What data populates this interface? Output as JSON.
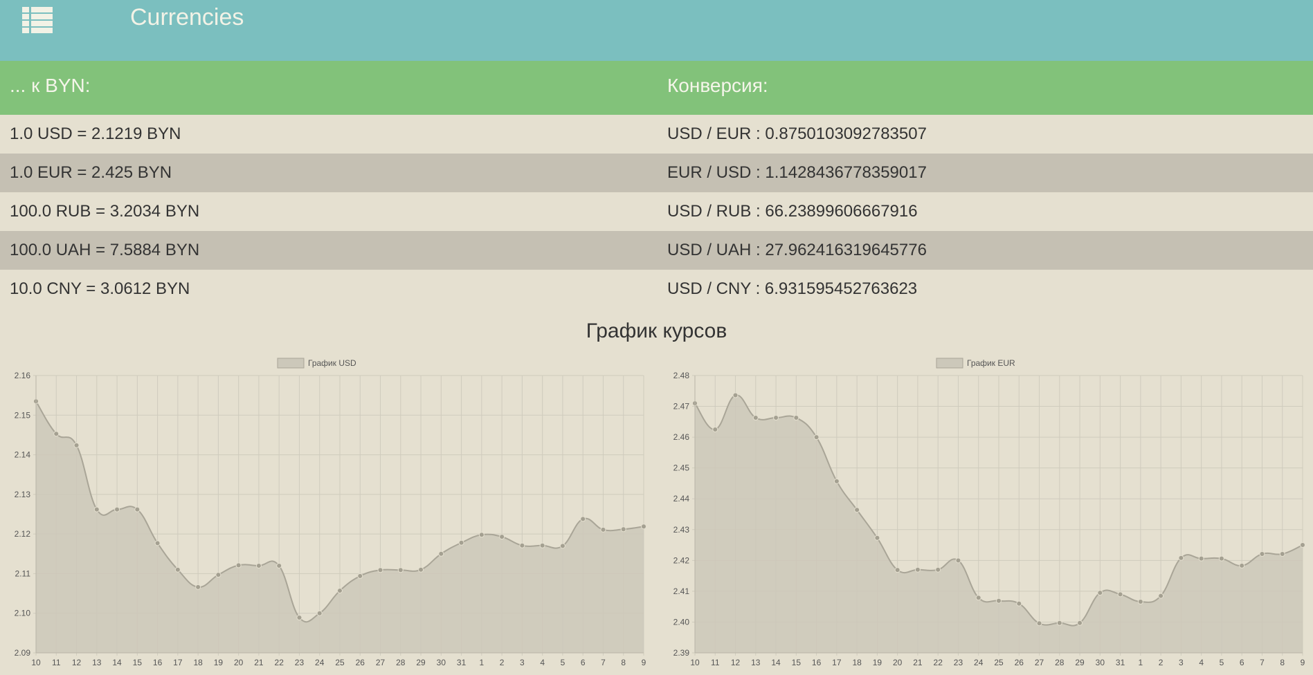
{
  "app": {
    "title": "Currencies",
    "menu_icon": "list-menu-icon"
  },
  "header": {
    "left": "... к BYN:",
    "right": "Конверсия:"
  },
  "rows": [
    {
      "rate": "1.0 USD = 2.1219 BYN",
      "conversion": "USD / EUR : 0.8750103092783507"
    },
    {
      "rate": "1.0 EUR = 2.425 BYN",
      "conversion": "EUR / USD : 1.1428436778359017"
    },
    {
      "rate": "100.0 RUB = 3.2034 BYN",
      "conversion": "USD / RUB : 66.23899606667916"
    },
    {
      "rate": "100.0 UAH = 7.5884 BYN",
      "conversion": "USD / UAH : 27.962416319645776"
    },
    {
      "rate": "10.0 CNY = 3.0612 BYN",
      "conversion": "USD / CNY : 6.931595452763623"
    }
  ],
  "charts_title": "График курсов",
  "chart_data": [
    {
      "type": "area",
      "title": "",
      "categories": [
        "10",
        "11",
        "12",
        "13",
        "14",
        "15",
        "16",
        "17",
        "18",
        "19",
        "20",
        "21",
        "22",
        "23",
        "24",
        "25",
        "26",
        "27",
        "28",
        "29",
        "30",
        "31",
        "1",
        "2",
        "3",
        "4",
        "5",
        "6",
        "7",
        "8",
        "9"
      ],
      "series": [
        {
          "name": "График USD",
          "values": [
            2.1535,
            2.1453,
            2.1424,
            2.1262,
            2.1262,
            2.1262,
            2.1177,
            2.111,
            2.1066,
            2.1097,
            2.1121,
            2.112,
            2.112,
            2.0989,
            2.1,
            2.1057,
            2.1094,
            2.1109,
            2.1109,
            2.111,
            2.115,
            2.1178,
            2.1198,
            2.1193,
            2.1171,
            2.1171,
            2.117,
            2.1238,
            2.1211,
            2.1212,
            2.1219
          ]
        }
      ],
      "ylim": [
        2.09,
        2.16
      ],
      "yticks": [
        "2.16",
        "2.15",
        "2.14",
        "2.13",
        "2.12",
        "2.11",
        "2.10",
        "2.09"
      ],
      "grid": true,
      "legend": "top-center",
      "colors": {
        "fill": "#ccc8ba",
        "line": "#a9a597",
        "point": "#a4a091",
        "grid": "#cfcbbd"
      }
    },
    {
      "type": "area",
      "title": "",
      "categories": [
        "10",
        "11",
        "12",
        "13",
        "14",
        "15",
        "16",
        "17",
        "18",
        "19",
        "20",
        "21",
        "22",
        "23",
        "24",
        "25",
        "26",
        "27",
        "28",
        "29",
        "30",
        "31",
        "1",
        "2",
        "3",
        "4",
        "5",
        "6",
        "7",
        "8",
        "9"
      ],
      "series": [
        {
          "name": "График EUR",
          "values": [
            2.471,
            2.4625,
            2.4736,
            2.4663,
            2.4663,
            2.4663,
            2.46,
            2.4457,
            2.4364,
            2.4273,
            2.4169,
            2.417,
            2.417,
            2.42,
            2.4079,
            2.4069,
            2.406,
            2.3996,
            2.3997,
            2.3997,
            2.4095,
            2.409,
            2.4066,
            2.4085,
            2.4208,
            2.4206,
            2.4206,
            2.4183,
            2.4221,
            2.4221,
            2.425
          ]
        }
      ],
      "ylim": [
        2.39,
        2.48
      ],
      "yticks": [
        "2.48",
        "2.47",
        "2.46",
        "2.45",
        "2.44",
        "2.43",
        "2.42",
        "2.41",
        "2.40",
        "2.39"
      ],
      "grid": true,
      "legend": "top-center",
      "colors": {
        "fill": "#ccc8ba",
        "line": "#a9a597",
        "point": "#a4a091",
        "grid": "#cfcbbd"
      }
    }
  ]
}
